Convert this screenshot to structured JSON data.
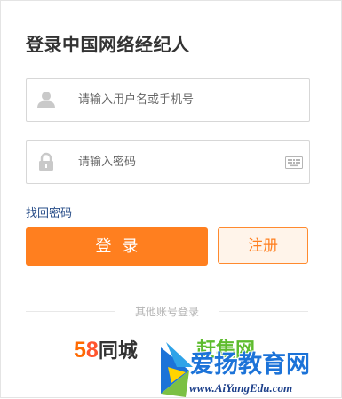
{
  "title": "登录中国网络经纪人",
  "username_field": {
    "placeholder": "请输入用户名或手机号",
    "icon": "user-icon"
  },
  "password_field": {
    "placeholder": "请输入密码",
    "icon": "lock-icon",
    "keyboard_icon": "keyboard-icon"
  },
  "forgot_password_label": "找回密码",
  "login_button_label": "登录",
  "register_button_label": "注册",
  "other_login_label": "其他账号登录",
  "third_party": {
    "logo_58": {
      "digit1": "5",
      "digit2": "8",
      "name": "同城"
    },
    "logo_ganji": "赶集网"
  },
  "watermark": {
    "main": "爱扬教育网",
    "url": "www.AiYangEdu.com"
  },
  "colors": {
    "accent": "#ff7f1f",
    "link": "#2a4f8a",
    "ganji_green": "#5ebc2e",
    "watermark_blue": "#1c73d8"
  }
}
